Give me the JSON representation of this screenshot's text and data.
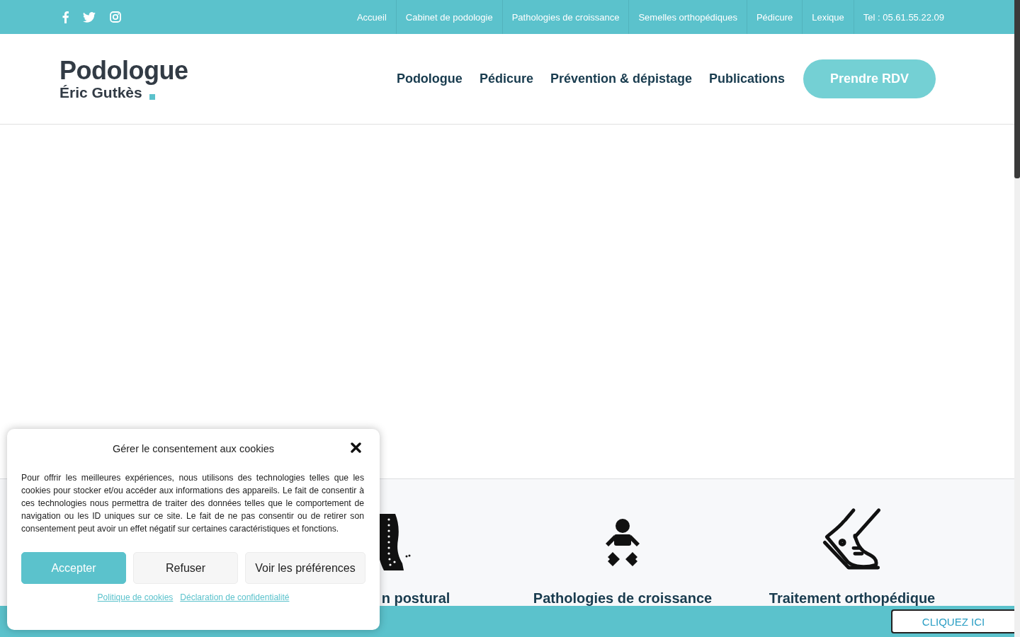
{
  "top_bar": {
    "social": [
      {
        "kind": "facebook"
      },
      {
        "kind": "twitter"
      },
      {
        "kind": "instagram"
      }
    ],
    "links": [
      "Accueil",
      "Cabinet de podologie",
      "Pathologies de croissance",
      "Semelles orthopédiques",
      "Pédicure",
      "Lexique",
      "Tel : 05.61.55.22.09"
    ]
  },
  "header": {
    "logo_title": "Podologue",
    "logo_subtitle": "Éric Gutkès",
    "nav": [
      "Podologue",
      "Pédicure",
      "Prévention & dépistage",
      "Publications"
    ],
    "cta": "Prendre RDV"
  },
  "services": [
    {
      "kind": "spine",
      "title": "n postural"
    },
    {
      "kind": "baby",
      "title": "Pathologies de croissance"
    },
    {
      "kind": "shoe",
      "title": "Traitement orthopédique"
    }
  ],
  "bottom_bar": {
    "button": "CLIQUEZ ICI"
  },
  "cookie_dialog": {
    "title": "Gérer le consentement aux cookies",
    "text": "Pour offrir les meilleures expériences, nous utilisons des technologies telles que les cookies pour stocker et/ou accéder aux informations des appareils. Le fait de consentir à ces technologies nous permettra de traiter des données telles que le comportement de navigation ou les ID uniques sur ce site. Le fait de ne pas consentir ou de retirer son consentement peut avoir un effet négatif sur certaines caractéristiques et fonctions.",
    "buttons": [
      {
        "label": "Accepter",
        "kind": "primary"
      },
      {
        "label": "Refuser",
        "kind": "secondary"
      },
      {
        "label": "Voir les préférences",
        "kind": "secondary"
      }
    ],
    "links": [
      "Politique de cookies",
      "Déclaration de confidentialité"
    ]
  }
}
